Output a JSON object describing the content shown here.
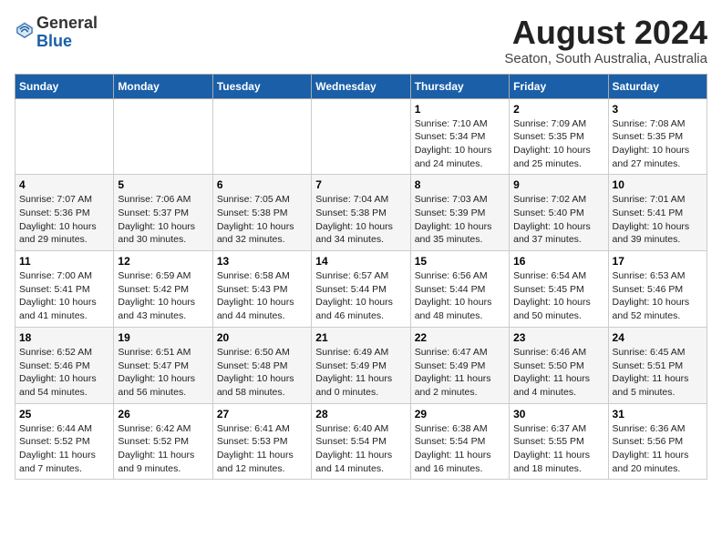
{
  "header": {
    "logo_general": "General",
    "logo_blue": "Blue",
    "month_year": "August 2024",
    "location": "Seaton, South Australia, Australia"
  },
  "days_of_week": [
    "Sunday",
    "Monday",
    "Tuesday",
    "Wednesday",
    "Thursday",
    "Friday",
    "Saturday"
  ],
  "weeks": [
    [
      {
        "day": "",
        "info": ""
      },
      {
        "day": "",
        "info": ""
      },
      {
        "day": "",
        "info": ""
      },
      {
        "day": "",
        "info": ""
      },
      {
        "day": "1",
        "info": "Sunrise: 7:10 AM\nSunset: 5:34 PM\nDaylight: 10 hours\nand 24 minutes."
      },
      {
        "day": "2",
        "info": "Sunrise: 7:09 AM\nSunset: 5:35 PM\nDaylight: 10 hours\nand 25 minutes."
      },
      {
        "day": "3",
        "info": "Sunrise: 7:08 AM\nSunset: 5:35 PM\nDaylight: 10 hours\nand 27 minutes."
      }
    ],
    [
      {
        "day": "4",
        "info": "Sunrise: 7:07 AM\nSunset: 5:36 PM\nDaylight: 10 hours\nand 29 minutes."
      },
      {
        "day": "5",
        "info": "Sunrise: 7:06 AM\nSunset: 5:37 PM\nDaylight: 10 hours\nand 30 minutes."
      },
      {
        "day": "6",
        "info": "Sunrise: 7:05 AM\nSunset: 5:38 PM\nDaylight: 10 hours\nand 32 minutes."
      },
      {
        "day": "7",
        "info": "Sunrise: 7:04 AM\nSunset: 5:38 PM\nDaylight: 10 hours\nand 34 minutes."
      },
      {
        "day": "8",
        "info": "Sunrise: 7:03 AM\nSunset: 5:39 PM\nDaylight: 10 hours\nand 35 minutes."
      },
      {
        "day": "9",
        "info": "Sunrise: 7:02 AM\nSunset: 5:40 PM\nDaylight: 10 hours\nand 37 minutes."
      },
      {
        "day": "10",
        "info": "Sunrise: 7:01 AM\nSunset: 5:41 PM\nDaylight: 10 hours\nand 39 minutes."
      }
    ],
    [
      {
        "day": "11",
        "info": "Sunrise: 7:00 AM\nSunset: 5:41 PM\nDaylight: 10 hours\nand 41 minutes."
      },
      {
        "day": "12",
        "info": "Sunrise: 6:59 AM\nSunset: 5:42 PM\nDaylight: 10 hours\nand 43 minutes."
      },
      {
        "day": "13",
        "info": "Sunrise: 6:58 AM\nSunset: 5:43 PM\nDaylight: 10 hours\nand 44 minutes."
      },
      {
        "day": "14",
        "info": "Sunrise: 6:57 AM\nSunset: 5:44 PM\nDaylight: 10 hours\nand 46 minutes."
      },
      {
        "day": "15",
        "info": "Sunrise: 6:56 AM\nSunset: 5:44 PM\nDaylight: 10 hours\nand 48 minutes."
      },
      {
        "day": "16",
        "info": "Sunrise: 6:54 AM\nSunset: 5:45 PM\nDaylight: 10 hours\nand 50 minutes."
      },
      {
        "day": "17",
        "info": "Sunrise: 6:53 AM\nSunset: 5:46 PM\nDaylight: 10 hours\nand 52 minutes."
      }
    ],
    [
      {
        "day": "18",
        "info": "Sunrise: 6:52 AM\nSunset: 5:46 PM\nDaylight: 10 hours\nand 54 minutes."
      },
      {
        "day": "19",
        "info": "Sunrise: 6:51 AM\nSunset: 5:47 PM\nDaylight: 10 hours\nand 56 minutes."
      },
      {
        "day": "20",
        "info": "Sunrise: 6:50 AM\nSunset: 5:48 PM\nDaylight: 10 hours\nand 58 minutes."
      },
      {
        "day": "21",
        "info": "Sunrise: 6:49 AM\nSunset: 5:49 PM\nDaylight: 11 hours\nand 0 minutes."
      },
      {
        "day": "22",
        "info": "Sunrise: 6:47 AM\nSunset: 5:49 PM\nDaylight: 11 hours\nand 2 minutes."
      },
      {
        "day": "23",
        "info": "Sunrise: 6:46 AM\nSunset: 5:50 PM\nDaylight: 11 hours\nand 4 minutes."
      },
      {
        "day": "24",
        "info": "Sunrise: 6:45 AM\nSunset: 5:51 PM\nDaylight: 11 hours\nand 5 minutes."
      }
    ],
    [
      {
        "day": "25",
        "info": "Sunrise: 6:44 AM\nSunset: 5:52 PM\nDaylight: 11 hours\nand 7 minutes."
      },
      {
        "day": "26",
        "info": "Sunrise: 6:42 AM\nSunset: 5:52 PM\nDaylight: 11 hours\nand 9 minutes."
      },
      {
        "day": "27",
        "info": "Sunrise: 6:41 AM\nSunset: 5:53 PM\nDaylight: 11 hours\nand 12 minutes."
      },
      {
        "day": "28",
        "info": "Sunrise: 6:40 AM\nSunset: 5:54 PM\nDaylight: 11 hours\nand 14 minutes."
      },
      {
        "day": "29",
        "info": "Sunrise: 6:38 AM\nSunset: 5:54 PM\nDaylight: 11 hours\nand 16 minutes."
      },
      {
        "day": "30",
        "info": "Sunrise: 6:37 AM\nSunset: 5:55 PM\nDaylight: 11 hours\nand 18 minutes."
      },
      {
        "day": "31",
        "info": "Sunrise: 6:36 AM\nSunset: 5:56 PM\nDaylight: 11 hours\nand 20 minutes."
      }
    ]
  ]
}
